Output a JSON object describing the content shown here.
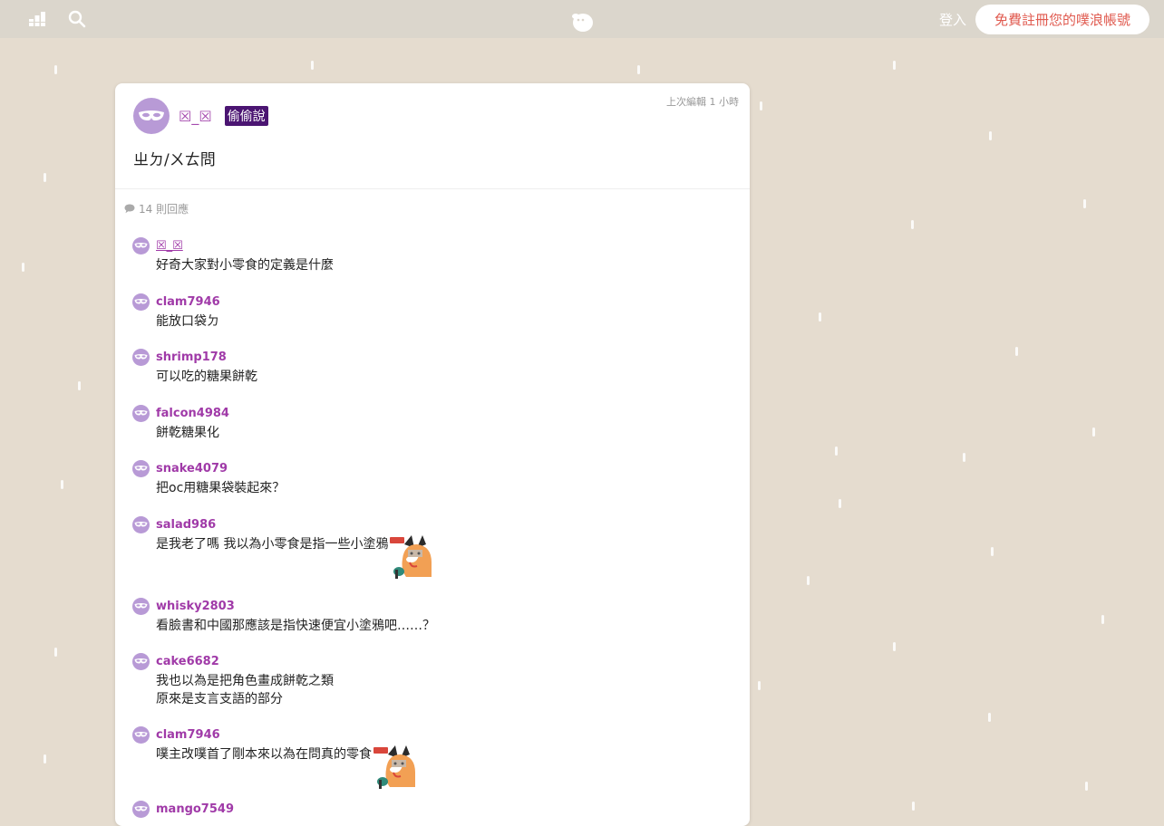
{
  "topbar": {
    "login_label": "登入",
    "signup_label": "免費註冊您的噗浪帳號"
  },
  "post": {
    "author": "☒_☒",
    "badge": "偷偷說",
    "edited": "上次編輯 1 小時",
    "content": "ㄓㄉ/ㄨㄊ問",
    "response_count": "14 則回應"
  },
  "responses": [
    {
      "name": "☒_☒",
      "text": "好奇大家對小零食的定義是什麼",
      "sticker": false
    },
    {
      "name": "clam7946",
      "text": "能放口袋ㄉ",
      "sticker": false
    },
    {
      "name": "shrimp178",
      "text": "可以吃的糖果餅乾",
      "sticker": false
    },
    {
      "name": "falcon4984",
      "text": "餅乾糖果化",
      "sticker": false
    },
    {
      "name": "snake4079",
      "text": "把oc用糖果袋裝起來？",
      "sticker": false
    },
    {
      "name": "salad986",
      "text": "是我老了嗎 我以為小零食是指一些小塗鴉",
      "sticker": true
    },
    {
      "name": "whisky2803",
      "text": "看臉書和中國那應該是指快速便宜小塗鴉吧……？",
      "sticker": false
    },
    {
      "name": "cake6682",
      "text": "我也以為是把角色畫成餅乾之類\n原來是支言支語的部分",
      "sticker": false
    },
    {
      "name": "clam7946",
      "text": "噗主改噗首了剛本來以為在問真的零食",
      "sticker": true
    },
    {
      "name": "mango7549",
      "text": "",
      "sticker": false
    }
  ],
  "icons": {
    "stats": "bar-chart-icon",
    "search": "search-icon",
    "logo": "plurk-logo",
    "mask": "mask-icon",
    "comment": "comment-icon"
  },
  "colors": {
    "background": "#e5dccf",
    "topbar": "#dbd6cc",
    "accent": "#e05a4f",
    "username": "#a03aa8",
    "badge": "#4b1572",
    "avatar": "#b89ad6"
  }
}
